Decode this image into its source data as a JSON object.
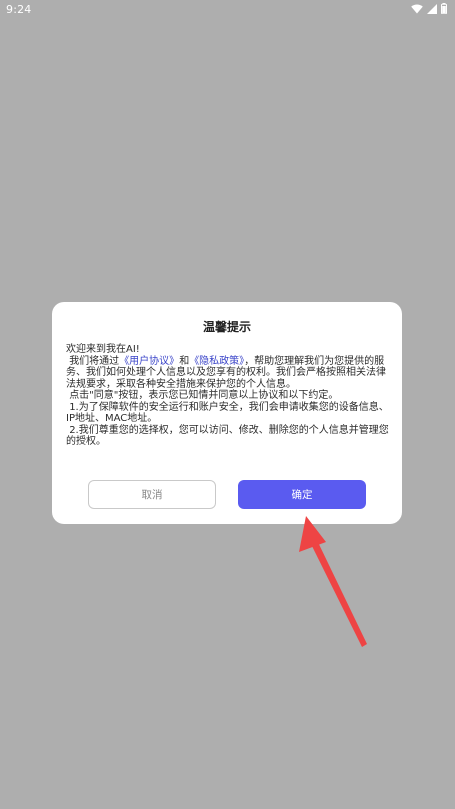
{
  "status_bar": {
    "time": "9:24",
    "icons": [
      "wifi-icon",
      "signal-icon",
      "battery-icon"
    ]
  },
  "dialog": {
    "title": "温馨提示",
    "greeting": "欢迎来到我在AI!",
    "p1_pre": "我们将通过",
    "user_agreement": "《用户协议》",
    "p1_and": "和",
    "privacy_policy": "《隐私政策》",
    "p1_post": "，帮助您理解我们为您提供的服务、我们如何处理个人信息以及您享有的权利。我们会严格按照相关法律法规要求，采取各种安全措施来保护您的个人信息。",
    "p2": "点击\"同意\"按钮，表示您已知情并同意以上协议和以下约定。",
    "p3": "1.为了保障软件的安全运行和账户安全，我们会申请收集您的设备信息、IP地址、MAC地址。",
    "p4": "2.我们尊重您的选择权，您可以访问、修改、删除您的个人信息并管理您的授权。",
    "cancel_label": "取消",
    "confirm_label": "确定"
  },
  "colors": {
    "overlay": "#aeaeae",
    "confirm_button": "#5a5bf0",
    "link": "#3b45c9",
    "arrow": "#ee4444"
  }
}
